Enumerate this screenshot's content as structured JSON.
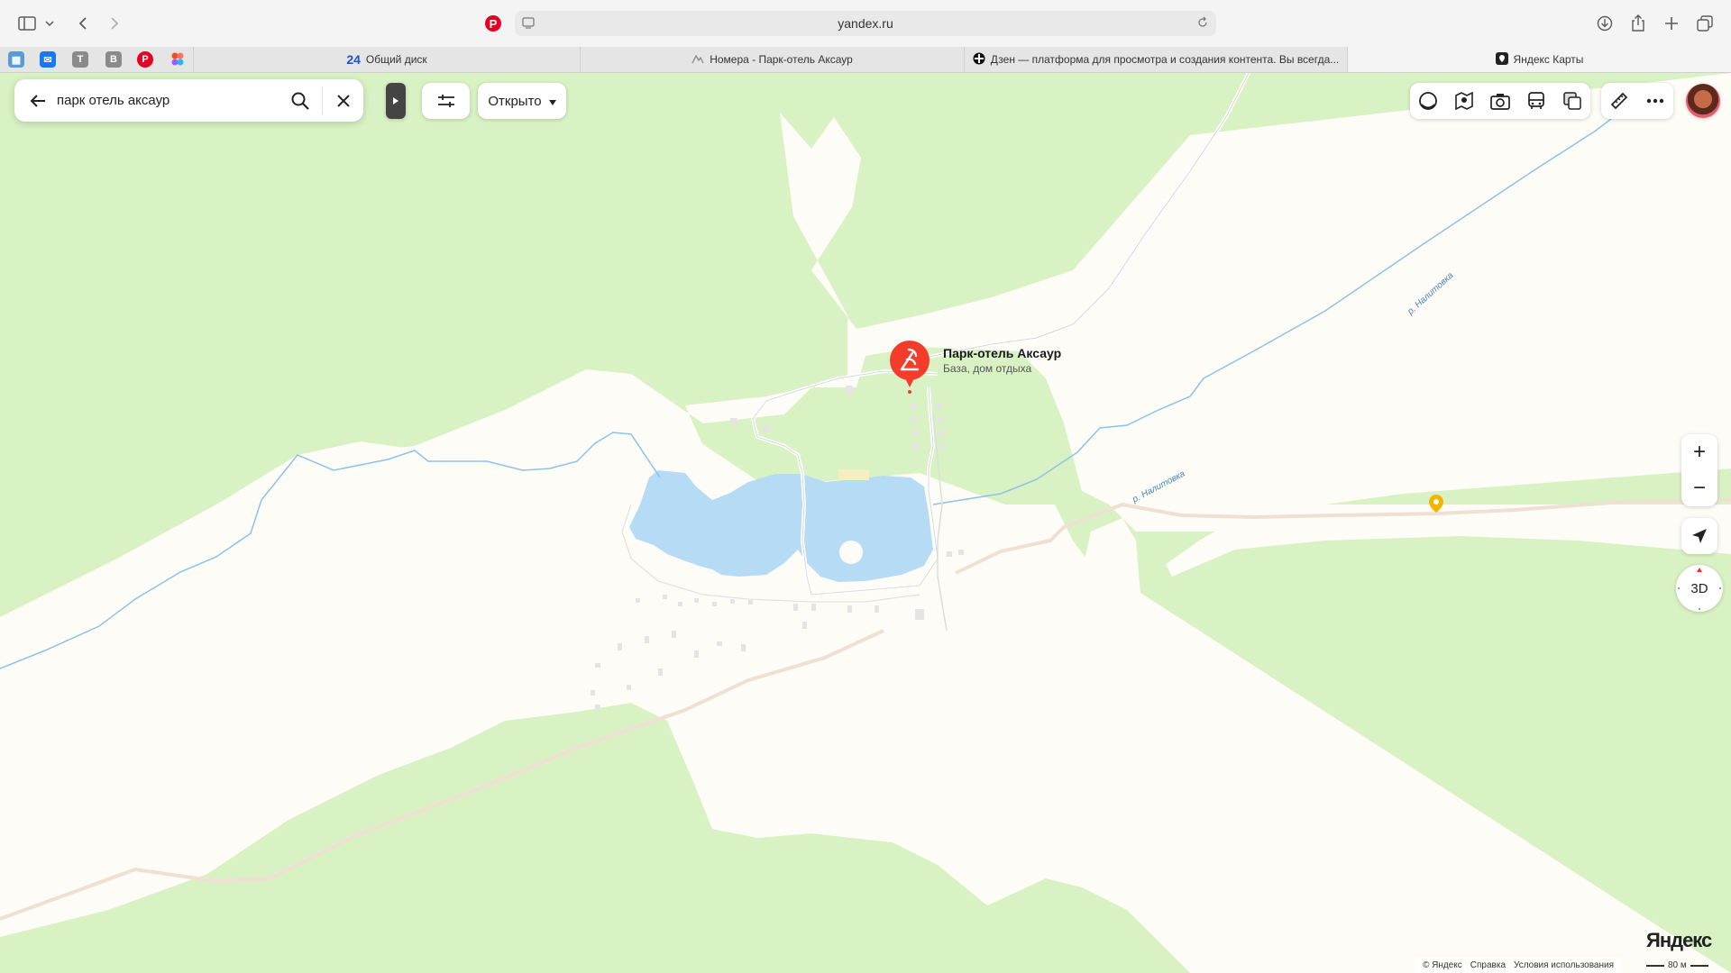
{
  "browser": {
    "url": "yandex.ru",
    "tabs": [
      {
        "label": "24",
        "title": "Общий диск"
      },
      {
        "title": "Номера - Парк-отель Аксаур"
      },
      {
        "title": "Дзен — платформа для просмотра и создания контента. Вы всегда..."
      },
      {
        "title": "Яндекс Карты"
      }
    ],
    "bookmarks": [
      {
        "icon": "calendar-icon",
        "color": "#5b9bd5"
      },
      {
        "icon": "mail-icon",
        "color": "#1877f2"
      },
      {
        "icon": "t-icon",
        "label": "T",
        "color": "#8a8a8a"
      },
      {
        "icon": "vk-icon",
        "label": "В",
        "color": "#8a8a8a"
      },
      {
        "icon": "pinterest-icon",
        "color": "#e60023"
      },
      {
        "icon": "figma-icon",
        "color": "#a259ff"
      }
    ]
  },
  "search": {
    "query": "парк отель аксаур"
  },
  "filters": {
    "open_label": "Открыто"
  },
  "layers": [
    "traffic-icon",
    "panorama-icon",
    "camera-icon",
    "transport-icon",
    "layers-icon"
  ],
  "tools": [
    "ruler-icon",
    "more-icon"
  ],
  "poi": {
    "title": "Парк-отель Аксаур",
    "subtitle": "База, дом отдыха",
    "color": "#f43c2b"
  },
  "rivers": [
    {
      "label": "р. Налитовка"
    },
    {
      "label": "р. Налитовка"
    }
  ],
  "map_colors": {
    "forest": "#d8f2c3",
    "land": "#fdfcf7",
    "water": "#b6dcf5",
    "river": "#8ec2e8",
    "road": "#f0e0d4"
  },
  "controls": {
    "zoom_in": "+",
    "zoom_out": "−",
    "btn_3d": "3D"
  },
  "branding": {
    "logo": "Яндекс"
  },
  "footer": {
    "links": [
      "© Яндекс",
      "Справка",
      "Условия использования"
    ],
    "scale": "80 м"
  }
}
